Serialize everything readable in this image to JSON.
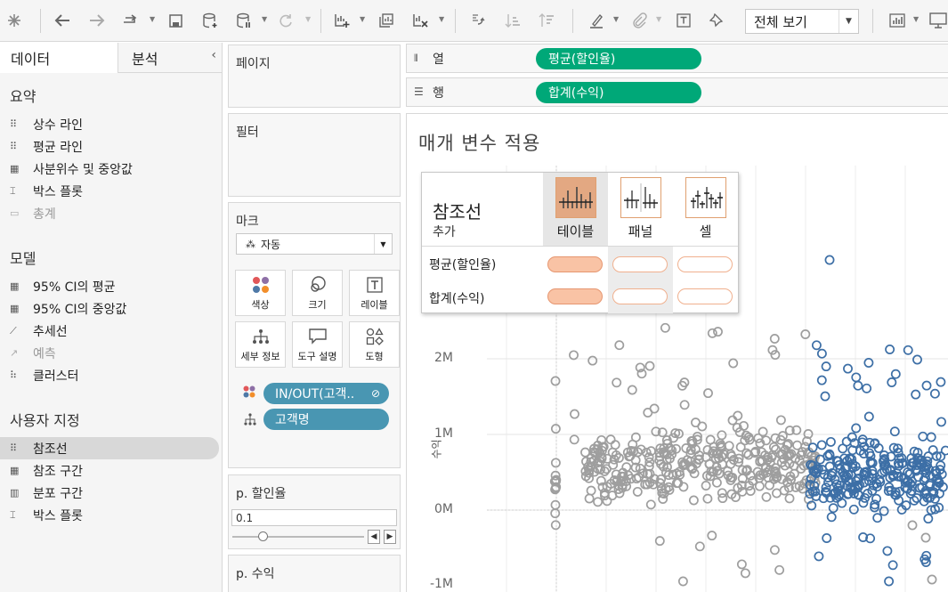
{
  "toolbar": {
    "view_select": "전체 보기",
    "icons": [
      "tableau-logo-icon",
      "undo-icon",
      "redo-icon",
      "forward-icon",
      "save-icon",
      "new-datasource-icon",
      "pause-icon",
      "refresh-icon",
      "new-worksheet-icon",
      "duplicate-icon",
      "clear-icon",
      "swap-icon",
      "sort-asc-icon",
      "sort-desc-icon",
      "highlight-icon",
      "annotate-icon",
      "label-icon",
      "pin-icon",
      "show-me-icon",
      "presentation-icon"
    ]
  },
  "left_panel": {
    "tab_data": "데이터",
    "tab_analysis": "분석",
    "summary_title": "요약",
    "summary_items": [
      "상수 라인",
      "평균 라인",
      "사분위수 및 중앙값",
      "박스 플롯",
      "총계"
    ],
    "model_title": "모델",
    "model_items": [
      "95% CI의 평균",
      "95% CI의 중앙값",
      "추세선",
      "예측",
      "클러스터"
    ],
    "custom_title": "사용자 지정",
    "custom_items": [
      "참조선",
      "참조 구간",
      "분포 구간",
      "박스 플롯"
    ]
  },
  "cards": {
    "pages": "페이지",
    "filters": "필터",
    "marks": "마크",
    "mark_type": "자동",
    "mark_buttons": [
      "색상",
      "크기",
      "레이블",
      "세부 정보",
      "도구 설명",
      "도형"
    ],
    "mark_pills": [
      "IN/OUT(고객..",
      "고객명"
    ],
    "param1_title": "p. 할인율",
    "param1_value": "0.1",
    "param2_title": "p. 수익"
  },
  "shelves": {
    "columns_label": "열",
    "columns_pill": "평균(할인율)",
    "rows_label": "행",
    "rows_pill": "합계(수익)"
  },
  "view": {
    "title": "매개 변수 적용",
    "y_axis_label": "수익",
    "y_ticks": [
      "2M",
      "1M",
      "0M",
      "-1M"
    ]
  },
  "popup": {
    "title": "참조선",
    "subtitle": "추가",
    "options": [
      "테이블",
      "패널",
      "셀"
    ],
    "fields": [
      "평균(할인율)",
      "합계(수익)"
    ]
  },
  "chart_data": {
    "type": "scatter",
    "xlabel": "",
    "ylabel": "수익",
    "y_ticks": [
      "2M",
      "1M",
      "0M",
      "-1M"
    ],
    "ylim": [
      -1000000,
      3000000
    ],
    "series": [
      {
        "name": "",
        "color": "#9e9e9e"
      },
      {
        "name": "",
        "color": "#3d6fa6"
      }
    ]
  },
  "colors": {
    "green_pill": "#00a878",
    "blue_pill": "#4996b2",
    "scatter_gray": "#9e9e9e",
    "scatter_blue": "#3d6fa6",
    "popup_accent": "#f9c3a5"
  }
}
